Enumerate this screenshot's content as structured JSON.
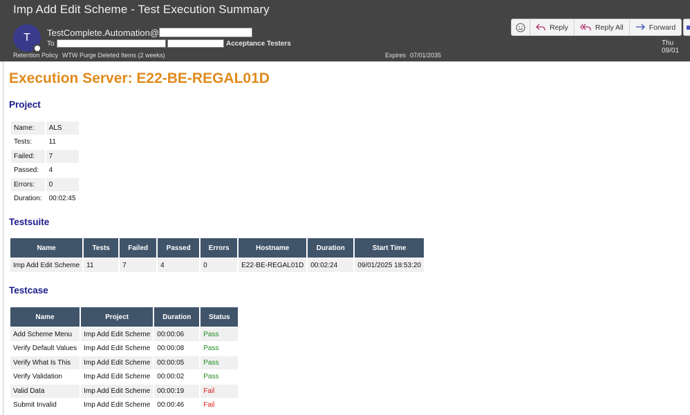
{
  "email": {
    "subject": "Imp Add Edit Scheme - Test Execution Summary",
    "avatar_initial": "T",
    "sender": "TestComplete.Automation@",
    "to_label": "To",
    "to_group": "Acceptance Testers",
    "retention_label": "Retention Policy",
    "retention_value": "WTW Purge Deleted Items (2 weeks)",
    "expires_label": "Expires",
    "expires_value": "07/01/2035",
    "date_short": "Thu 09/01",
    "actions": {
      "reply": "Reply",
      "reply_all": "Reply All",
      "forward": "Forward"
    }
  },
  "report": {
    "server_title": "Execution Server: E22-BE-REGAL01D",
    "project_heading": "Project",
    "project": [
      {
        "key": "Name:",
        "value": "ALS"
      },
      {
        "key": "Tests:",
        "value": "11"
      },
      {
        "key": "Failed:",
        "value": "7"
      },
      {
        "key": "Passed:",
        "value": "4"
      },
      {
        "key": "Errors:",
        "value": "0"
      },
      {
        "key": "Duration:",
        "value": "00:02:45"
      }
    ],
    "testsuite_heading": "Testsuite",
    "testsuite_headers": [
      "Name",
      "Tests",
      "Failed",
      "Passed",
      "Errors",
      "Hostname",
      "Duration",
      "Start Time"
    ],
    "testsuite_row": [
      "Imp Add Edit Scheme",
      "11",
      "7",
      "4",
      "0",
      "E22-BE-REGAL01D",
      "00:02:24",
      "09/01/2025 18:53:20"
    ],
    "testcase_heading": "Testcase",
    "testcase_headers": [
      "Name",
      "Project",
      "Duration",
      "Status"
    ],
    "testcases": [
      {
        "name": "Add Scheme Menu",
        "project": "Imp Add Edit Scheme",
        "duration": "00:00:06",
        "status": "Pass"
      },
      {
        "name": "Verify Default Values",
        "project": "Imp Add Edit Scheme",
        "duration": "00:00:08",
        "status": "Pass"
      },
      {
        "name": "Verify What Is This",
        "project": "Imp Add Edit Scheme",
        "duration": "00:00:05",
        "status": "Pass"
      },
      {
        "name": "Verify Validation",
        "project": "Imp Add Edit Scheme",
        "duration": "00:00:02",
        "status": "Pass"
      },
      {
        "name": "Valid Data",
        "project": "Imp Add Edit Scheme",
        "duration": "00:00:19",
        "status": "Fail"
      },
      {
        "name": "Submit Invalid",
        "project": "Imp Add Edit Scheme",
        "duration": "00:00:46",
        "status": "Fail"
      }
    ]
  },
  "colors": {
    "header_bg": "#444444",
    "title_orange": "#e08a1c",
    "heading_navy": "#1a1a8c",
    "table_header": "#40546a",
    "pass_green": "#1e8c1e",
    "fail_red": "#dd1a1a"
  }
}
